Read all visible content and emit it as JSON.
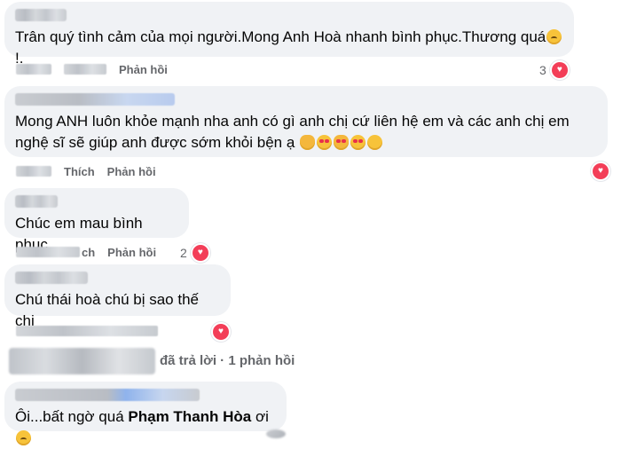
{
  "comments": [
    {
      "text": "Trân quý tình cảm của mọi người.Mong Anh Hoà nhanh bình phục.Thương quá",
      "text_suffix": "!.",
      "reply_label": "Phản hồi",
      "reaction_count": "3"
    },
    {
      "text": "Mong ANH luôn khỏe mạnh nha anh có gì anh chị cứ liên hệ em và các anh chị em nghệ sĩ sẽ giúp anh được sớm khỏi bện ạ",
      "like_label": "Thích",
      "reply_label": "Phản hồi"
    },
    {
      "text": "Chúc em mau bình phục.",
      "like_label": "ch",
      "reply_label": "Phản hồi",
      "reaction_count": "2"
    },
    {
      "text": "Chú thái hoà chú bị sao thế chị"
    },
    {
      "text_before": "Ôi...bất ngờ quá ",
      "mention": "Phạm Thanh Hòa",
      "text_after": " ơi"
    }
  ],
  "replies_summary": "đã trả lời · 1 phản hồi",
  "icons": {
    "heart": "heart-icon",
    "emoji": "emoji-icon"
  },
  "colors": {
    "bubble": "#f0f2f5",
    "meta": "#65676b",
    "heart": "#f33e58"
  }
}
